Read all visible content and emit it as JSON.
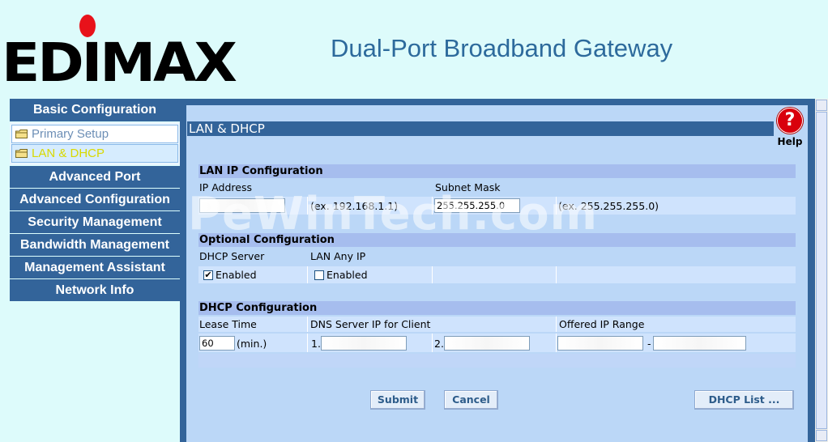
{
  "header": {
    "logo": "EDIMAX",
    "title": "Dual-Port Broadband Gateway"
  },
  "sidebar": {
    "section": "Basic Configuration",
    "sub_items": [
      {
        "label": "Primary Setup",
        "icon": "folder-icon"
      },
      {
        "label": "LAN & DHCP",
        "icon": "folder-icon"
      }
    ],
    "items": [
      {
        "label": "Advanced Port"
      },
      {
        "label": "Advanced Configuration"
      },
      {
        "label": "Security Management"
      },
      {
        "label": "Bandwidth Management"
      },
      {
        "label": "Management Assistant"
      },
      {
        "label": "Network Info"
      }
    ]
  },
  "main": {
    "section_title": "LAN & DHCP",
    "help_label": "Help",
    "watermark": "PeWinTech.com",
    "lan_ip": {
      "heading": "LAN IP Configuration",
      "ip_label": "IP Address",
      "ip_value": "",
      "ip_hint": "(ex. 192.168.1.1)",
      "mask_label": "Subnet Mask",
      "mask_value": "255.255.255.0",
      "mask_hint": "(ex. 255.255.255.0)"
    },
    "optional": {
      "heading": "Optional Configuration",
      "dhcp_server_label": "DHCP Server",
      "dhcp_server_checkbox": "Enabled",
      "lan_any_ip_label": "LAN Any IP",
      "lan_any_ip_checkbox": "Enabled"
    },
    "dhcp": {
      "heading": "DHCP Configuration",
      "lease_label": "Lease Time",
      "lease_value": "60",
      "lease_unit": "(min.)",
      "dns_label": "DNS Server IP for Client",
      "dns1_prefix": "1.",
      "dns2_prefix": "2.",
      "range_label": "Offered IP Range",
      "range_sep": "-"
    },
    "buttons": {
      "submit": "Submit",
      "cancel": "Cancel",
      "dhcp_list": "DHCP List ..."
    }
  },
  "colors": {
    "brand_blue": "#33649a",
    "title_blue": "#2d6a9c",
    "logo_red": "#e8121a",
    "help_red": "#d9000c"
  }
}
